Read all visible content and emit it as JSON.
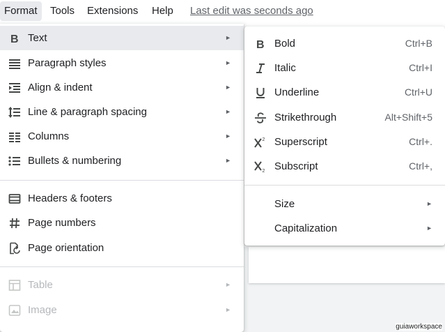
{
  "menubar": {
    "items": [
      "Format",
      "Tools",
      "Extensions",
      "Help"
    ],
    "last_edit": "Last edit was seconds ago"
  },
  "format_menu": {
    "items": [
      {
        "label": "Text",
        "icon": "bold-b-icon"
      },
      {
        "label": "Paragraph styles",
        "icon": "paragraph-styles-icon"
      },
      {
        "label": "Align & indent",
        "icon": "align-indent-icon"
      },
      {
        "label": "Line & paragraph spacing",
        "icon": "line-spacing-icon"
      },
      {
        "label": "Columns",
        "icon": "columns-icon"
      },
      {
        "label": "Bullets & numbering",
        "icon": "bulleted-list-icon"
      },
      {
        "label": "Headers & footers",
        "icon": "headers-footers-icon"
      },
      {
        "label": "Page numbers",
        "icon": "hash-icon"
      },
      {
        "label": "Page orientation",
        "icon": "page-orientation-icon"
      },
      {
        "label": "Table",
        "icon": "table-icon"
      },
      {
        "label": "Image",
        "icon": "image-icon"
      }
    ],
    "submenu_arrow": "►"
  },
  "text_submenu": {
    "items": [
      {
        "label": "Bold",
        "shortcut": "Ctrl+B",
        "icon": "bold-icon"
      },
      {
        "label": "Italic",
        "shortcut": "Ctrl+I",
        "icon": "italic-icon"
      },
      {
        "label": "Underline",
        "shortcut": "Ctrl+U",
        "icon": "underline-icon"
      },
      {
        "label": "Strikethrough",
        "shortcut": "Alt+Shift+5",
        "icon": "strikethrough-icon"
      },
      {
        "label": "Superscript",
        "shortcut": "Ctrl+.",
        "icon": "superscript-icon"
      },
      {
        "label": "Subscript",
        "shortcut": "Ctrl+,",
        "icon": "subscript-icon"
      },
      {
        "label": "Size"
      },
      {
        "label": "Capitalization"
      }
    ]
  },
  "watermark": "guiaworkspace"
}
